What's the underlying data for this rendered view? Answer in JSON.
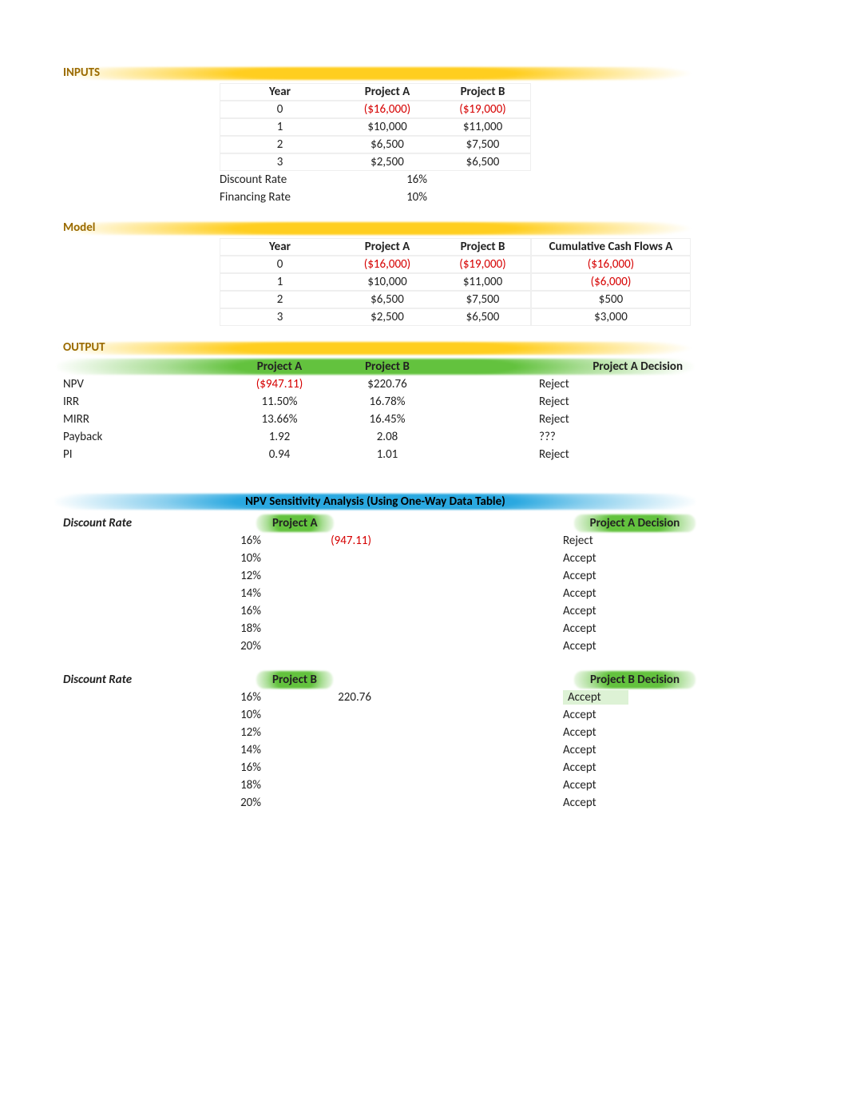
{
  "sections": {
    "inputs": "INPUTS",
    "model": "Model",
    "output": "OUTPUT",
    "sensitivity": "NPV Sensitivity Analysis (Using One-Way Data Table)"
  },
  "headers": {
    "year": "Year",
    "projA": "Project A",
    "projB": "Project B",
    "cumA": "Cumulative Cash Flows A",
    "decisionA": "Project A Decision",
    "decisionB": "Project B Decision",
    "discountRate": "Discount Rate"
  },
  "inputs": {
    "rows": [
      {
        "year": "0",
        "a": "($16,000)",
        "aNeg": true,
        "b": "($19,000)",
        "bNeg": true
      },
      {
        "year": "1",
        "a": "$10,000",
        "b": "$11,000"
      },
      {
        "year": "2",
        "a": "$6,500",
        "b": "$7,500"
      },
      {
        "year": "3",
        "a": "$2,500",
        "b": "$6,500"
      }
    ],
    "discountRateLabel": "Discount Rate",
    "discountRate": "16%",
    "financingRateLabel": "Financing Rate",
    "financingRate": "10%"
  },
  "model": {
    "rows": [
      {
        "year": "0",
        "a": "($16,000)",
        "aNeg": true,
        "b": "($19,000)",
        "bNeg": true,
        "cum": "($16,000)",
        "cumNeg": true
      },
      {
        "year": "1",
        "a": "$10,000",
        "b": "$11,000",
        "cum": "($6,000)",
        "cumNeg": true
      },
      {
        "year": "2",
        "a": "$6,500",
        "b": "$7,500",
        "cum": "$500"
      },
      {
        "year": "3",
        "a": "$2,500",
        "b": "$6,500",
        "cum": "$3,000"
      }
    ]
  },
  "output": {
    "metrics": [
      {
        "name": "NPV",
        "a": "($947.11)",
        "aNeg": true,
        "b": "$220.76",
        "decision": "Reject"
      },
      {
        "name": "IRR",
        "a": "11.50%",
        "b": "16.78%",
        "decision": "Reject"
      },
      {
        "name": "MIRR",
        "a": "13.66%",
        "b": "16.45%",
        "decision": "Reject"
      },
      {
        "name": "Payback",
        "a": "1.92",
        "b": "2.08",
        "decision": "???"
      },
      {
        "name": "PI",
        "a": "0.94",
        "b": "1.01",
        "decision": "Reject"
      }
    ]
  },
  "sensitivity": {
    "A": {
      "headerRate": "16%",
      "value": "(947.11)",
      "valueNeg": true,
      "decisionTop": "Reject",
      "rows": [
        {
          "rate": "10%",
          "decision": "Accept"
        },
        {
          "rate": "12%",
          "decision": "Accept"
        },
        {
          "rate": "14%",
          "decision": "Accept"
        },
        {
          "rate": "16%",
          "decision": "Accept"
        },
        {
          "rate": "18%",
          "decision": "Accept"
        },
        {
          "rate": "20%",
          "decision": "Accept"
        }
      ]
    },
    "B": {
      "headerRate": "16%",
      "value": "220.76",
      "decisionTop": "Accept",
      "rows": [
        {
          "rate": "10%",
          "decision": "Accept"
        },
        {
          "rate": "12%",
          "decision": "Accept"
        },
        {
          "rate": "14%",
          "decision": "Accept"
        },
        {
          "rate": "16%",
          "decision": "Accept"
        },
        {
          "rate": "18%",
          "decision": "Accept"
        },
        {
          "rate": "20%",
          "decision": "Accept"
        }
      ]
    }
  },
  "chart_data": {
    "type": "table",
    "title": "Capital Budgeting Model — Inputs, Model, Output, NPV Sensitivity",
    "inputs_cashflows": {
      "years": [
        0,
        1,
        2,
        3
      ],
      "project_a": [
        -16000,
        10000,
        6500,
        2500
      ],
      "project_b": [
        -19000,
        11000,
        7500,
        6500
      ]
    },
    "discount_rate": 0.16,
    "financing_rate": 0.1,
    "model_cumulative_cashflows_a": [
      -16000,
      -6000,
      500,
      3000
    ],
    "output": {
      "NPV": {
        "project_a": -947.11,
        "project_b": 220.76,
        "decision_a": "Reject"
      },
      "IRR": {
        "project_a": 0.115,
        "project_b": 0.1678,
        "decision_a": "Reject"
      },
      "MIRR": {
        "project_a": 0.1366,
        "project_b": 0.1645,
        "decision_a": "Reject"
      },
      "Payback": {
        "project_a": 1.92,
        "project_b": 2.08,
        "decision_a": "???"
      },
      "PI": {
        "project_a": 0.94,
        "project_b": 1.01,
        "decision_a": "Reject"
      }
    },
    "npv_sensitivity": {
      "project_a": {
        "rate": 0.16,
        "npv": -947.11,
        "decision": "Reject",
        "table": [
          {
            "rate": 0.1,
            "decision": "Accept"
          },
          {
            "rate": 0.12,
            "decision": "Accept"
          },
          {
            "rate": 0.14,
            "decision": "Accept"
          },
          {
            "rate": 0.16,
            "decision": "Accept"
          },
          {
            "rate": 0.18,
            "decision": "Accept"
          },
          {
            "rate": 0.2,
            "decision": "Accept"
          }
        ]
      },
      "project_b": {
        "rate": 0.16,
        "npv": 220.76,
        "decision": "Accept",
        "table": [
          {
            "rate": 0.1,
            "decision": "Accept"
          },
          {
            "rate": 0.12,
            "decision": "Accept"
          },
          {
            "rate": 0.14,
            "decision": "Accept"
          },
          {
            "rate": 0.16,
            "decision": "Accept"
          },
          {
            "rate": 0.18,
            "decision": "Accept"
          },
          {
            "rate": 0.2,
            "decision": "Accept"
          }
        ]
      }
    }
  }
}
